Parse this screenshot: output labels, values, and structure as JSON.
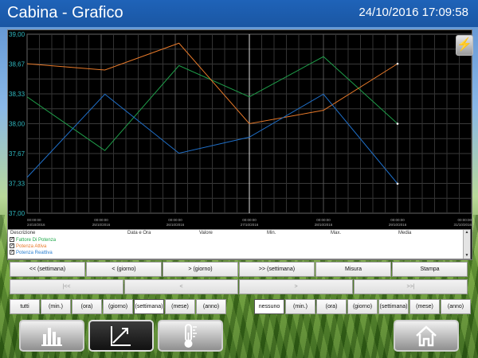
{
  "header": {
    "title": "Cabina - Grafico",
    "datetime": "24/10/2016 17:09:58"
  },
  "chart_data": {
    "type": "line",
    "y_ticks": [
      "39,00",
      "38,67",
      "38,33",
      "38,00",
      "37,67",
      "37,33",
      "37,00"
    ],
    "ylim": [
      37.0,
      39.0
    ],
    "x_ticks": [
      {
        "time": "00:00:00",
        "date": "24/10/2016"
      },
      {
        "time": "00:00:00",
        "date": "25/10/2016"
      },
      {
        "time": "00:00:00",
        "date": "26/10/2016"
      },
      {
        "time": "00:00:00",
        "date": "27/10/2016"
      },
      {
        "time": "00:00:00",
        "date": "28/10/2016"
      },
      {
        "time": "00:00:00",
        "date": "29/10/2016"
      },
      {
        "time": "00:00:00",
        "date": "31/10/2016"
      }
    ],
    "series": [
      {
        "name": "Fattore Di Potenza",
        "color": "#1f9e4a",
        "x": [
          0,
          1.05,
          2.05,
          3.0,
          4.0,
          5.0
        ],
        "values": [
          38.3,
          37.7,
          38.65,
          38.3,
          38.75,
          38.0
        ]
      },
      {
        "name": "Potenza Attiva",
        "color": "#e87a2a",
        "x": [
          0,
          1.05,
          2.05,
          3.0,
          4.0,
          5.0
        ],
        "values": [
          38.67,
          38.6,
          38.9,
          38.0,
          38.15,
          38.67
        ]
      },
      {
        "name": "Potenza Reattiva",
        "color": "#1f6fc8",
        "x": [
          0,
          1.05,
          2.05,
          3.0,
          4.0,
          5.0
        ],
        "values": [
          37.4,
          38.33,
          37.67,
          37.85,
          38.33,
          37.33
        ]
      }
    ],
    "cursor_x": 3.0,
    "grid": true
  },
  "info": {
    "columns": [
      "Descrizione",
      "Data e Ora",
      "Valore",
      "Min.",
      "Max.",
      "Media"
    ],
    "legend": [
      {
        "label": "Fattore Di Potenza",
        "color": "#1fa84a",
        "checked": "✓"
      },
      {
        "label": "Potenza Attiva",
        "color": "#e87a2a",
        "checked": "✓"
      },
      {
        "label": "Potenza Reattiva",
        "color": "#2a7fd0",
        "checked": "✓"
      }
    ]
  },
  "nav_row": [
    {
      "label": "<< (settimana)"
    },
    {
      "label": "< (giorno)"
    },
    {
      "label": "> (giorno)"
    },
    {
      "label": ">> (settimana)"
    },
    {
      "label": "Misura"
    },
    {
      "label": "Stampa"
    }
  ],
  "step_row": [
    {
      "label": "|<<"
    },
    {
      "label": "<"
    },
    {
      "label": ">"
    },
    {
      "label": ">>|"
    }
  ],
  "range_left": [
    {
      "label": "tutti"
    },
    {
      "label": "(min.)"
    },
    {
      "label": "(ora)"
    },
    {
      "label": "(giorno)"
    },
    {
      "label": "(settimana)"
    },
    {
      "label": "(mese)"
    },
    {
      "label": "(anno)"
    }
  ],
  "range_right": [
    {
      "label": "nessuno"
    },
    {
      "label": "(min.)"
    },
    {
      "label": "(ora)"
    },
    {
      "label": "(giorno)"
    },
    {
      "label": "(settimana)"
    },
    {
      "label": "(mese)"
    },
    {
      "label": "(anno)"
    }
  ],
  "range_left_selected": "(settimana)",
  "range_right_selected": "nessuno",
  "toolbar": {
    "buttons": [
      {
        "icon": "bar-chart-icon",
        "active": false
      },
      {
        "icon": "line-chart-icon",
        "active": true
      },
      {
        "icon": "thermometer-icon",
        "active": false
      },
      {
        "icon": "home-icon",
        "active": false
      }
    ]
  },
  "colors": {
    "header": "#1a56a3",
    "axis_text": "#2fb8c0",
    "grid": "#3a3a3a"
  }
}
